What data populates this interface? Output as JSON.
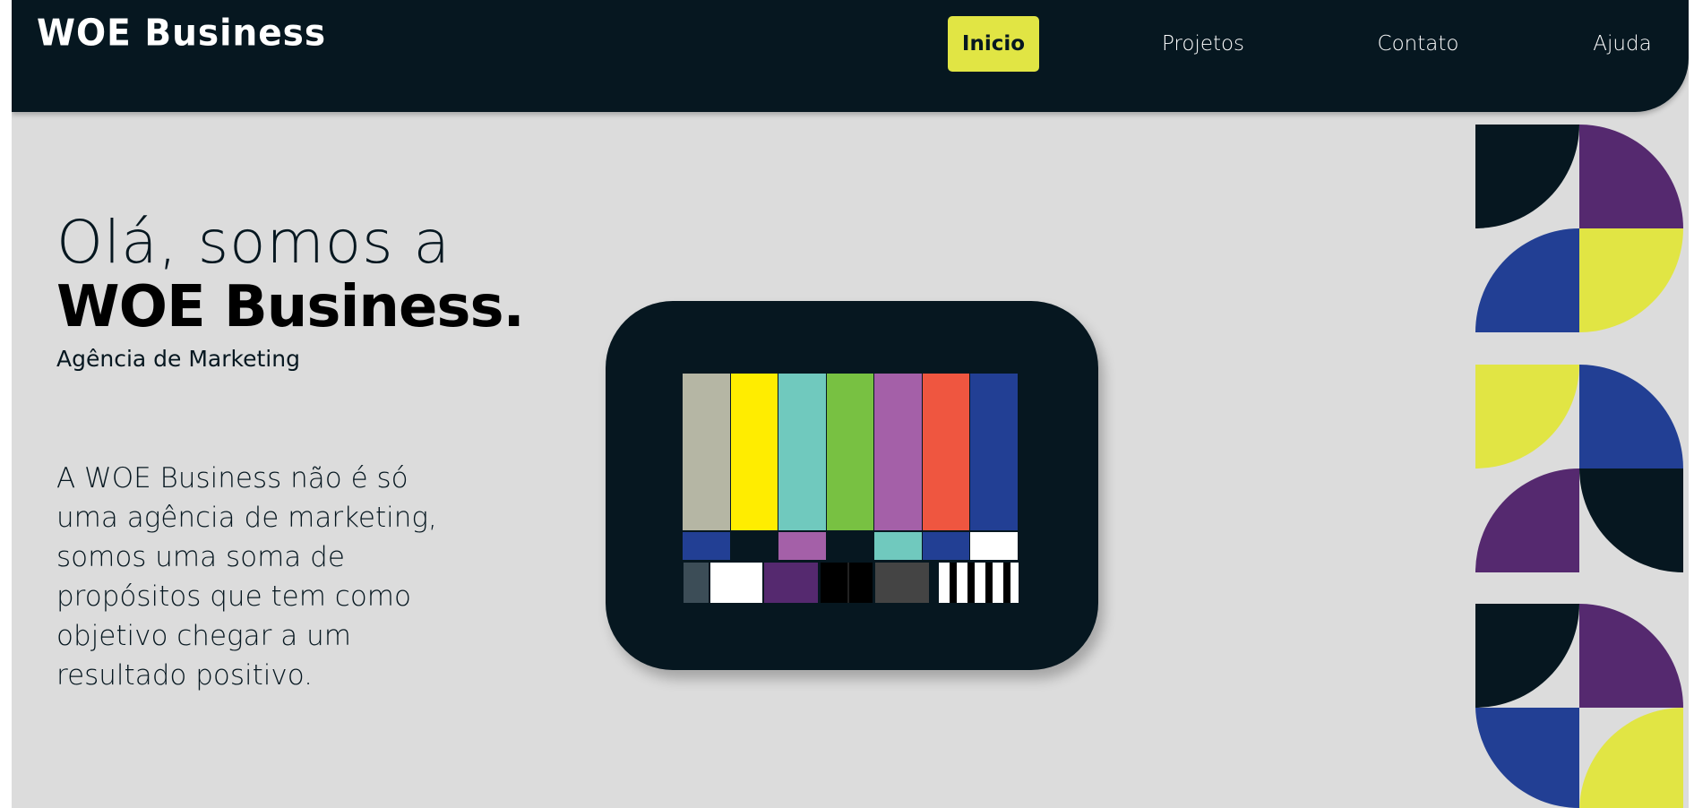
{
  "brand": {
    "name": "WOE Business"
  },
  "nav": {
    "items": [
      {
        "label": "Inicio",
        "active": true
      },
      {
        "label": "Projetos",
        "active": false
      },
      {
        "label": "Contato",
        "active": false
      },
      {
        "label": "Ajuda",
        "active": false
      }
    ]
  },
  "hero": {
    "greeting": "Olá, somos a",
    "title": "WOE Business.",
    "subtitle": "Agência de Marketing",
    "description": "A WOE Business não é só uma agência de marketing, somos uma soma de propósitos que tem como objetivo chegar a um resultado positivo."
  },
  "colors": {
    "dark": "#061720",
    "accent_yellow": "#e1e544",
    "purple": "#55296f",
    "blue": "#223f94",
    "background": "#dcdcdc"
  },
  "illustration": {
    "icon": "tv-test-pattern-icon",
    "top_bars": [
      "#b5b6a4",
      "#ffed00",
      "#70c9be",
      "#78c142",
      "#a460a8",
      "#ef5640",
      "#223f94"
    ],
    "middle_bars": [
      "#223f94",
      "#061720",
      "#a460a8",
      "#061720",
      "#70c9be",
      "#223f94",
      "#ffffff"
    ],
    "bottom_bars": [
      "#3c4d57",
      "#ffffff",
      "#55296f",
      "#000000",
      "#444444",
      "#stripes"
    ]
  },
  "decoration": {
    "icon": "geometric-shapes-icon"
  }
}
